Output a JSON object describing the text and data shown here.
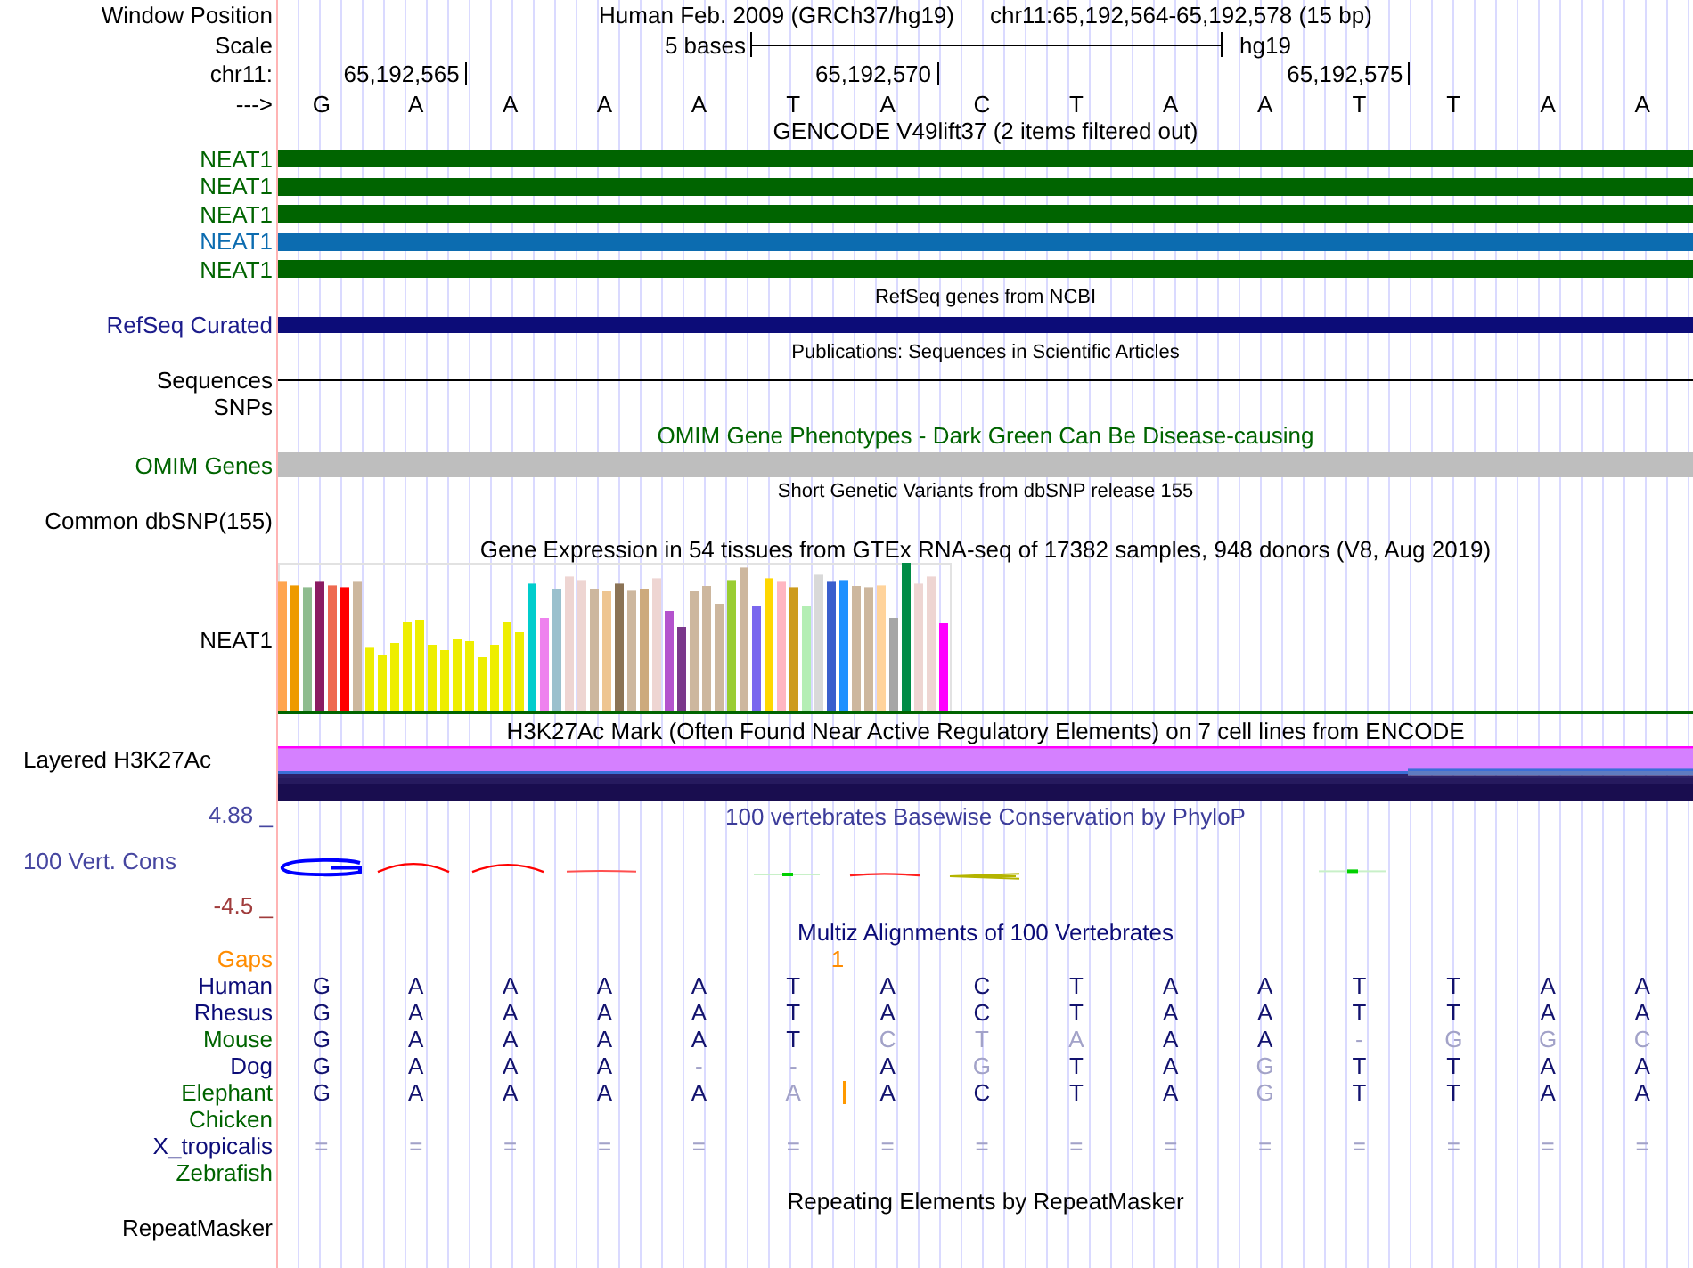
{
  "header": {
    "position_label": "Window Position",
    "assembly": "Human Feb. 2009 (GRCh37/hg19)",
    "position": "chr11:65,192,564-65,192,578 (15 bp)",
    "scale_label": "Scale",
    "scale": "5 bases",
    "scale_assembly": "hg19",
    "chrom_label": "chr11:",
    "ticks": [
      "65,192,565",
      "65,192,570",
      "65,192,575"
    ],
    "strand_label": "--->",
    "bases": [
      "G",
      "A",
      "A",
      "A",
      "A",
      "T",
      "A",
      "C",
      "T",
      "A",
      "A",
      "T",
      "T",
      "A",
      "A"
    ]
  },
  "gencode": {
    "title": "GENCODE V49lift37 (2 items filtered out)",
    "items": [
      {
        "label": "NEAT1",
        "color": "#006400"
      },
      {
        "label": "NEAT1",
        "color": "#006400"
      },
      {
        "label": "NEAT1",
        "color": "#006400"
      },
      {
        "label": "NEAT1",
        "color": "#0c6cb0"
      },
      {
        "label": "NEAT1",
        "color": "#006400"
      }
    ]
  },
  "refseq": {
    "title": "RefSeq genes from NCBI",
    "label": "RefSeq Curated"
  },
  "publications": {
    "title": "Publications: Sequences in Scientific Articles",
    "labels": [
      "Sequences",
      "SNPs"
    ]
  },
  "omim": {
    "title": "OMIM Gene Phenotypes - Dark Green Can Be Disease-causing",
    "label": "OMIM Genes"
  },
  "dbsnp": {
    "title": "Short Genetic Variants from dbSNP release 155",
    "label": "Common dbSNP(155)"
  },
  "gtex": {
    "title": "Gene Expression in 54 tissues from GTEx RNA-seq of 17382 samples, 948 donors (V8, Aug 2019)",
    "label": "NEAT1"
  },
  "h3k27ac": {
    "title": "H3K27Ac Mark (Often Found Near Active Regulatory Elements) on 7 cell lines from ENCODE",
    "label": "Layered H3K27Ac"
  },
  "phylop": {
    "title": "100 vertebrates Basewise Conservation by PhyloP",
    "label": "100 Vert. Cons",
    "max": "4.88 _",
    "min": "-4.5 _"
  },
  "multiz": {
    "title": "Multiz Alignments of 100 Vertebrates",
    "gaps": {
      "label": "Gaps",
      "count": "1"
    },
    "species": [
      {
        "name": "Human",
        "color": "#0c0c78",
        "bases": [
          {
            "base": "G",
            "match": true
          },
          {
            "base": "A",
            "match": true
          },
          {
            "base": "A",
            "match": true
          },
          {
            "base": "A",
            "match": true
          },
          {
            "base": "A",
            "match": true
          },
          {
            "base": "T",
            "match": true
          },
          {
            "base": "A",
            "match": true
          },
          {
            "base": "C",
            "match": true
          },
          {
            "base": "T",
            "match": true
          },
          {
            "base": "A",
            "match": true
          },
          {
            "base": "A",
            "match": true
          },
          {
            "base": "T",
            "match": true
          },
          {
            "base": "T",
            "match": true
          },
          {
            "base": "A",
            "match": true
          },
          {
            "base": "A",
            "match": true
          }
        ]
      },
      {
        "name": "Rhesus",
        "color": "#0c0c78",
        "bases": [
          {
            "base": "G",
            "match": true
          },
          {
            "base": "A",
            "match": true
          },
          {
            "base": "A",
            "match": true
          },
          {
            "base": "A",
            "match": true
          },
          {
            "base": "A",
            "match": true
          },
          {
            "base": "T",
            "match": true
          },
          {
            "base": "A",
            "match": true
          },
          {
            "base": "C",
            "match": true
          },
          {
            "base": "T",
            "match": true
          },
          {
            "base": "A",
            "match": true
          },
          {
            "base": "A",
            "match": true
          },
          {
            "base": "T",
            "match": true
          },
          {
            "base": "T",
            "match": true
          },
          {
            "base": "A",
            "match": true
          },
          {
            "base": "A",
            "match": true
          }
        ]
      },
      {
        "name": "Mouse",
        "color": "#006400",
        "bases": [
          {
            "base": "G",
            "match": true
          },
          {
            "base": "A",
            "match": true
          },
          {
            "base": "A",
            "match": true
          },
          {
            "base": "A",
            "match": true
          },
          {
            "base": "A",
            "match": true
          },
          {
            "base": "T",
            "match": true
          },
          {
            "base": "C",
            "match": false
          },
          {
            "base": "T",
            "match": false
          },
          {
            "base": "A",
            "match": false
          },
          {
            "base": "A",
            "match": true
          },
          {
            "base": "A",
            "match": true
          },
          {
            "base": "-",
            "match": false
          },
          {
            "base": "G",
            "match": false
          },
          {
            "base": "G",
            "match": false
          },
          {
            "base": "C",
            "match": false
          }
        ]
      },
      {
        "name": "Dog",
        "color": "#0c0c78",
        "bases": [
          {
            "base": "G",
            "match": true
          },
          {
            "base": "A",
            "match": true
          },
          {
            "base": "A",
            "match": true
          },
          {
            "base": "A",
            "match": true
          },
          {
            "base": "-",
            "match": false
          },
          {
            "base": "-",
            "match": false
          },
          {
            "base": "A",
            "match": true
          },
          {
            "base": "G",
            "match": false
          },
          {
            "base": "T",
            "match": true
          },
          {
            "base": "A",
            "match": true
          },
          {
            "base": "G",
            "match": false
          },
          {
            "base": "T",
            "match": true
          },
          {
            "base": "T",
            "match": true
          },
          {
            "base": "A",
            "match": true
          },
          {
            "base": "A",
            "match": true
          }
        ]
      },
      {
        "name": "Elephant",
        "color": "#006400",
        "bases": [
          {
            "base": "G",
            "match": true,
            "insertion": false
          },
          {
            "base": "A",
            "match": true,
            "insertion": false
          },
          {
            "base": "A",
            "match": true,
            "insertion": false
          },
          {
            "base": "A",
            "match": true,
            "insertion": false
          },
          {
            "base": "A",
            "match": true,
            "insertion": false
          },
          {
            "base": "A",
            "match": false,
            "insertion": true
          },
          {
            "base": "A",
            "match": true,
            "insertion": false
          },
          {
            "base": "C",
            "match": true,
            "insertion": false
          },
          {
            "base": "T",
            "match": true,
            "insertion": false
          },
          {
            "base": "A",
            "match": true,
            "insertion": false
          },
          {
            "base": "G",
            "match": false,
            "insertion": false
          },
          {
            "base": "T",
            "match": true,
            "insertion": false
          },
          {
            "base": "T",
            "match": true,
            "insertion": false
          },
          {
            "base": "A",
            "match": true,
            "insertion": false
          },
          {
            "base": "A",
            "match": true,
            "insertion": false
          }
        ]
      },
      {
        "name": "Chicken",
        "color": "#006400"
      },
      {
        "name": "X_tropicalis",
        "color": "#0c0c78",
        "bases": [
          {
            "base": "=",
            "match": false
          },
          {
            "base": "=",
            "match": false
          },
          {
            "base": "=",
            "match": false
          },
          {
            "base": "=",
            "match": false
          },
          {
            "base": "=",
            "match": false
          },
          {
            "base": "=",
            "match": false
          },
          {
            "base": "=",
            "match": false
          },
          {
            "base": "=",
            "match": false
          },
          {
            "base": "=",
            "match": false
          },
          {
            "base": "=",
            "match": false
          },
          {
            "base": "=",
            "match": false
          },
          {
            "base": "=",
            "match": false
          },
          {
            "base": "=",
            "match": false
          },
          {
            "base": "=",
            "match": false
          },
          {
            "base": "=",
            "match": false
          }
        ]
      },
      {
        "name": "Zebrafish",
        "color": "#006400"
      }
    ]
  },
  "repeatmasker": {
    "title": "Repeating Elements by RepeatMasker",
    "label": "RepeatMasker"
  }
}
